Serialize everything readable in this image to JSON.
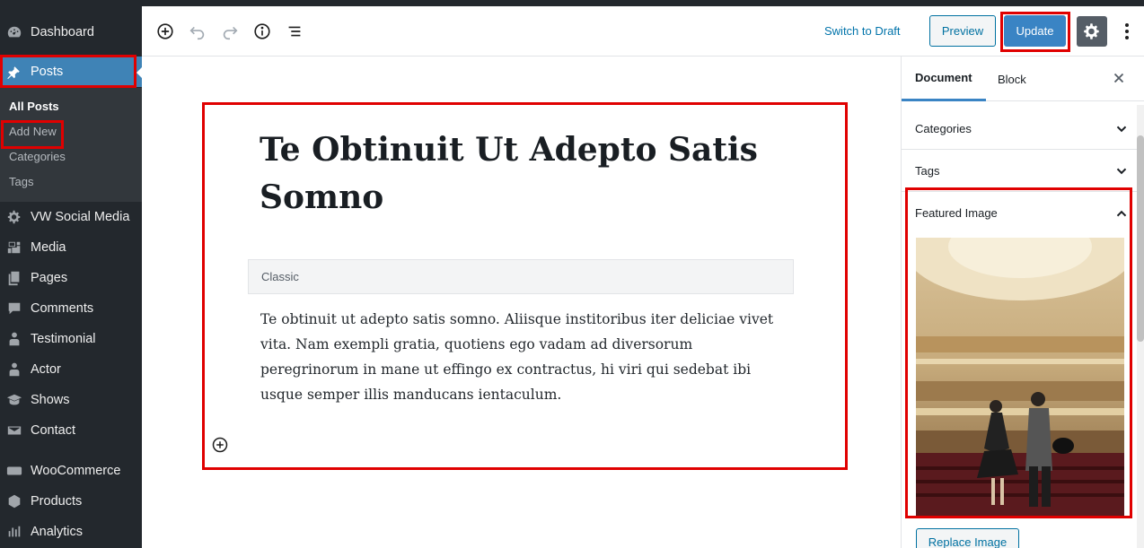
{
  "sidebar": {
    "items": [
      {
        "label": "Dashboard",
        "icon": "dashboard-icon"
      },
      {
        "label": "Posts",
        "icon": "pin-icon"
      },
      {
        "label": "VW Social Media",
        "icon": "gear-icon"
      },
      {
        "label": "Media",
        "icon": "media-icon"
      },
      {
        "label": "Pages",
        "icon": "pages-icon"
      },
      {
        "label": "Comments",
        "icon": "comment-icon"
      },
      {
        "label": "Testimonial",
        "icon": "person-icon"
      },
      {
        "label": "Actor",
        "icon": "person-icon"
      },
      {
        "label": "Shows",
        "icon": "shows-icon"
      },
      {
        "label": "Contact",
        "icon": "mail-icon"
      },
      {
        "label": "WooCommerce",
        "icon": "woo-icon"
      },
      {
        "label": "Products",
        "icon": "cube-icon"
      },
      {
        "label": "Analytics",
        "icon": "chart-icon"
      }
    ],
    "posts_submenu": [
      "All Posts",
      "Add New",
      "Categories",
      "Tags"
    ]
  },
  "toolbar": {
    "switch_to_draft": "Switch to Draft",
    "preview": "Preview",
    "update": "Update",
    "icons": [
      "add-block-icon",
      "undo-icon",
      "redo-icon",
      "info-icon",
      "outline-icon",
      "settings-icon",
      "more-icon"
    ]
  },
  "editor": {
    "title": "Te Obtinuit Ut Adepto Satis Somno",
    "classic_label": "Classic",
    "body": "Te obtinuit ut adepto satis somno. Aliisque institoribus iter deliciae vivet vita. Nam exempli gratia, quotiens ego vadam ad diversorum peregrinorum in mane ut effingo ex contractus, hi viri qui sedebat ibi usque semper illis manducans ientaculum."
  },
  "panel": {
    "tabs": [
      "Document",
      "Block"
    ],
    "sections": [
      "Categories",
      "Tags",
      "Featured Image"
    ],
    "replace_image": "Replace Image"
  },
  "colors": {
    "sidebar_bg": "#23282d",
    "accent": "#3a84c4",
    "highlight": "#e00000"
  }
}
